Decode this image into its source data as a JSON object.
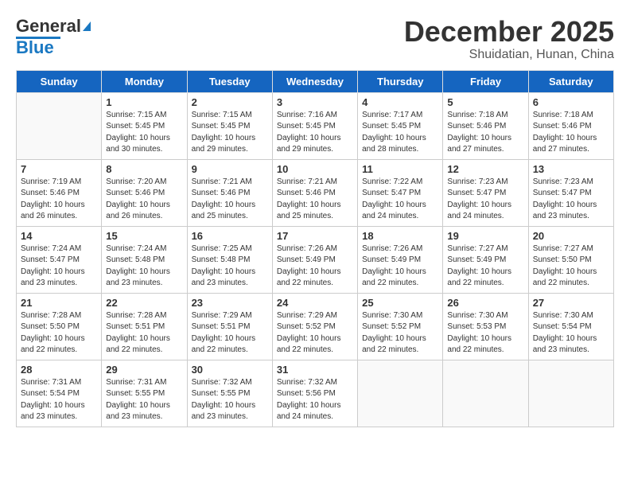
{
  "logo": {
    "line1": "General",
    "line2": "Blue"
  },
  "title": "December 2025",
  "subtitle": "Shuidatian, Hunan, China",
  "days_header": [
    "Sunday",
    "Monday",
    "Tuesday",
    "Wednesday",
    "Thursday",
    "Friday",
    "Saturday"
  ],
  "weeks": [
    [
      {
        "day": "",
        "info": ""
      },
      {
        "day": "1",
        "info": "Sunrise: 7:15 AM\nSunset: 5:45 PM\nDaylight: 10 hours\nand 30 minutes."
      },
      {
        "day": "2",
        "info": "Sunrise: 7:15 AM\nSunset: 5:45 PM\nDaylight: 10 hours\nand 29 minutes."
      },
      {
        "day": "3",
        "info": "Sunrise: 7:16 AM\nSunset: 5:45 PM\nDaylight: 10 hours\nand 29 minutes."
      },
      {
        "day": "4",
        "info": "Sunrise: 7:17 AM\nSunset: 5:45 PM\nDaylight: 10 hours\nand 28 minutes."
      },
      {
        "day": "5",
        "info": "Sunrise: 7:18 AM\nSunset: 5:46 PM\nDaylight: 10 hours\nand 27 minutes."
      },
      {
        "day": "6",
        "info": "Sunrise: 7:18 AM\nSunset: 5:46 PM\nDaylight: 10 hours\nand 27 minutes."
      }
    ],
    [
      {
        "day": "7",
        "info": "Sunrise: 7:19 AM\nSunset: 5:46 PM\nDaylight: 10 hours\nand 26 minutes."
      },
      {
        "day": "8",
        "info": "Sunrise: 7:20 AM\nSunset: 5:46 PM\nDaylight: 10 hours\nand 26 minutes."
      },
      {
        "day": "9",
        "info": "Sunrise: 7:21 AM\nSunset: 5:46 PM\nDaylight: 10 hours\nand 25 minutes."
      },
      {
        "day": "10",
        "info": "Sunrise: 7:21 AM\nSunset: 5:46 PM\nDaylight: 10 hours\nand 25 minutes."
      },
      {
        "day": "11",
        "info": "Sunrise: 7:22 AM\nSunset: 5:47 PM\nDaylight: 10 hours\nand 24 minutes."
      },
      {
        "day": "12",
        "info": "Sunrise: 7:23 AM\nSunset: 5:47 PM\nDaylight: 10 hours\nand 24 minutes."
      },
      {
        "day": "13",
        "info": "Sunrise: 7:23 AM\nSunset: 5:47 PM\nDaylight: 10 hours\nand 23 minutes."
      }
    ],
    [
      {
        "day": "14",
        "info": "Sunrise: 7:24 AM\nSunset: 5:47 PM\nDaylight: 10 hours\nand 23 minutes."
      },
      {
        "day": "15",
        "info": "Sunrise: 7:24 AM\nSunset: 5:48 PM\nDaylight: 10 hours\nand 23 minutes."
      },
      {
        "day": "16",
        "info": "Sunrise: 7:25 AM\nSunset: 5:48 PM\nDaylight: 10 hours\nand 23 minutes."
      },
      {
        "day": "17",
        "info": "Sunrise: 7:26 AM\nSunset: 5:49 PM\nDaylight: 10 hours\nand 22 minutes."
      },
      {
        "day": "18",
        "info": "Sunrise: 7:26 AM\nSunset: 5:49 PM\nDaylight: 10 hours\nand 22 minutes."
      },
      {
        "day": "19",
        "info": "Sunrise: 7:27 AM\nSunset: 5:49 PM\nDaylight: 10 hours\nand 22 minutes."
      },
      {
        "day": "20",
        "info": "Sunrise: 7:27 AM\nSunset: 5:50 PM\nDaylight: 10 hours\nand 22 minutes."
      }
    ],
    [
      {
        "day": "21",
        "info": "Sunrise: 7:28 AM\nSunset: 5:50 PM\nDaylight: 10 hours\nand 22 minutes."
      },
      {
        "day": "22",
        "info": "Sunrise: 7:28 AM\nSunset: 5:51 PM\nDaylight: 10 hours\nand 22 minutes."
      },
      {
        "day": "23",
        "info": "Sunrise: 7:29 AM\nSunset: 5:51 PM\nDaylight: 10 hours\nand 22 minutes."
      },
      {
        "day": "24",
        "info": "Sunrise: 7:29 AM\nSunset: 5:52 PM\nDaylight: 10 hours\nand 22 minutes."
      },
      {
        "day": "25",
        "info": "Sunrise: 7:30 AM\nSunset: 5:52 PM\nDaylight: 10 hours\nand 22 minutes."
      },
      {
        "day": "26",
        "info": "Sunrise: 7:30 AM\nSunset: 5:53 PM\nDaylight: 10 hours\nand 22 minutes."
      },
      {
        "day": "27",
        "info": "Sunrise: 7:30 AM\nSunset: 5:54 PM\nDaylight: 10 hours\nand 23 minutes."
      }
    ],
    [
      {
        "day": "28",
        "info": "Sunrise: 7:31 AM\nSunset: 5:54 PM\nDaylight: 10 hours\nand 23 minutes."
      },
      {
        "day": "29",
        "info": "Sunrise: 7:31 AM\nSunset: 5:55 PM\nDaylight: 10 hours\nand 23 minutes."
      },
      {
        "day": "30",
        "info": "Sunrise: 7:32 AM\nSunset: 5:55 PM\nDaylight: 10 hours\nand 23 minutes."
      },
      {
        "day": "31",
        "info": "Sunrise: 7:32 AM\nSunset: 5:56 PM\nDaylight: 10 hours\nand 24 minutes."
      },
      {
        "day": "",
        "info": ""
      },
      {
        "day": "",
        "info": ""
      },
      {
        "day": "",
        "info": ""
      }
    ]
  ]
}
